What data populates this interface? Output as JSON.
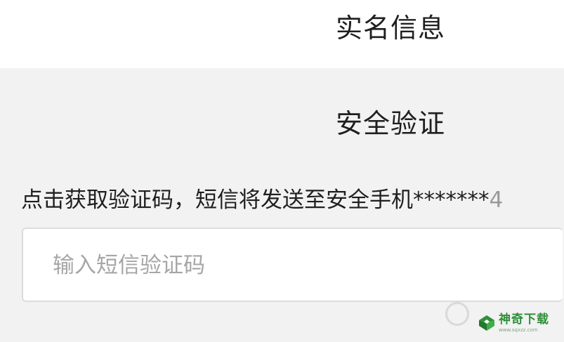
{
  "header": {
    "title": "实名信息"
  },
  "verification": {
    "title": "安全验证",
    "hint_text": "点击获取验证码，短信将发送至安全手机*******",
    "hint_cut": "4"
  },
  "code_input": {
    "value": "",
    "placeholder": "输入短信验证码"
  },
  "watermark": {
    "name": "神奇下载",
    "url": "www.sqxzz.com",
    "brand_color": "#2f8f3a"
  }
}
